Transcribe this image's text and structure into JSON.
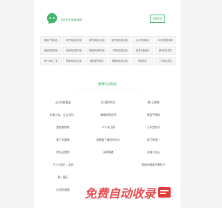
{
  "header": {
    "site_name": "QQ号在线查询网",
    "button_label": "查看手机"
  },
  "categories": [
    [
      "微信个性网名",
      "霸气网名男生版",
      "霸气网名女生版",
      "霸气网名男生版",
      "女人伤感网名",
      "QQ号码查询网"
    ],
    [
      "微信情侣网名",
      "霸道网名霸气版",
      "霸道网名霸气版",
      "个性网名男生版",
      "网名可爱网名",
      "霸气网名男生"
    ],
    [
      "唯一网名二字",
      "唯美网名男生版",
      "微信霸气网名",
      "唯美网名女生版",
      "情侣网名",
      "二字网名男生"
    ]
  ],
  "section": {
    "title": "推荐QQ网名"
  },
  "names": [
    [
      "山以伤感重温",
      "忆°爱的时光",
      "情°无独美"
    ],
    [
      "灰尾少女，丈夫当天。",
      "情绪的相对吧",
      "喂舍不得你"
    ],
    [
      "我很想你你",
      "々千年江湖",
      "万年宫所写"
    ],
    [
      "重了的爱情",
      "遗憾爱了最好的关心",
      "我门梦是一"
    ],
    [
      "时光还是你",
      "淡的情绪",
      "深海少女心"
    ],
    [
      "ㄗㄗㄗ我已，笑单",
      "",
      "熬夜的都我不勇肚子"
    ],
    [
      "我 ι 爱历",
      "",
      ""
    ],
    [
      "过滤的温暖",
      "",
      ""
    ]
  ],
  "watermark": {
    "text": "免费自动收录"
  },
  "colors": {
    "accent": "#41b56b",
    "watermark": "#e4393c"
  }
}
